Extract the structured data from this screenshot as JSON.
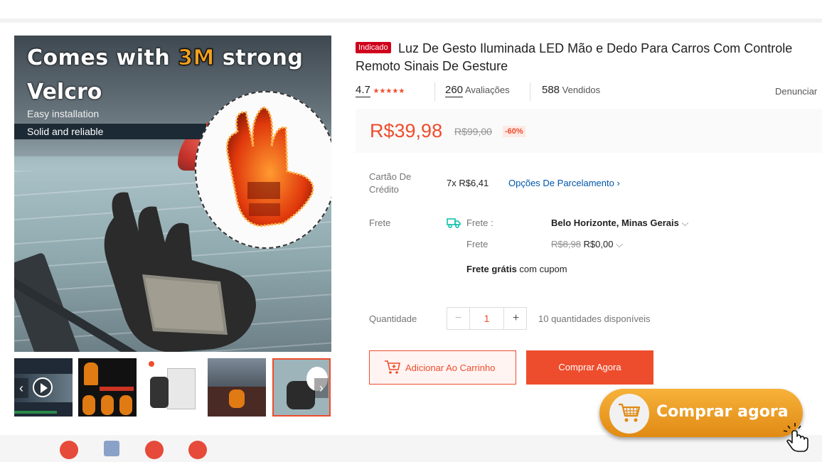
{
  "gallery": {
    "promo_line1_a": "Comes with ",
    "promo_line1_b": "3M",
    "promo_line1_c": " strong",
    "promo_line2": "Velcro",
    "promo_easy": "Easy installation",
    "promo_solid": "Solid and reliable",
    "thumb_prev_icon": "chevron-left-icon",
    "thumb_next_icon": "chevron-right-icon"
  },
  "product": {
    "badge": "Indicado",
    "title": "Luz De Gesto Iluminada LED Mão e Dedo Para Carros Com Controle Remoto Sinais De Gesture"
  },
  "stats": {
    "rating": "4.7",
    "rating_stars": 5,
    "reviews_count": "260",
    "reviews_label": "Avaliações",
    "sold_count": "588",
    "sold_label": "Vendidos",
    "report": "Denunciar"
  },
  "price": {
    "current": "R$39,98",
    "original": "R$99,00",
    "discount": "-60%"
  },
  "credit": {
    "label": "Cartão De Crédito",
    "installments": "7x R$6,41",
    "options_link": "Opções De Parcelamento"
  },
  "shipping": {
    "label": "Frete",
    "to_label": "Frete :",
    "to_value": "Belo Horizonte, Minas Gerais",
    "cost_label": "Frete",
    "cost_old": "R$8,98",
    "cost_new": "R$0,00",
    "free_bold": "Frete grátis",
    "free_rest": " com cupom"
  },
  "quantity": {
    "label": "Quantidade",
    "value": "1",
    "minus": "−",
    "plus": "+",
    "available": "10 quantidades disponíveis"
  },
  "buttons": {
    "add_to_cart": "Adicionar Ao Carrinho",
    "buy_now": "Comprar Agora"
  },
  "cta": {
    "label": "Comprar agora"
  },
  "colors": {
    "accent": "#ee4d2d",
    "cta": "#f0a020",
    "link": "#0055aa"
  }
}
